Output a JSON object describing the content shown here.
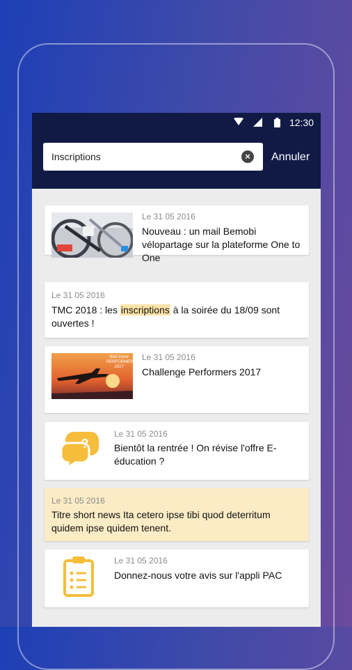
{
  "status_bar": {
    "time": "12:30"
  },
  "search": {
    "value": "Inscriptions",
    "cancel_label": "Annuler"
  },
  "news": [
    {
      "date": "Le 31 05 2016",
      "title": "Nouveau : un mail Bemobi vélopartage sur la plateforme One to One",
      "media": "bike-photo"
    },
    {
      "date": "Le 31 05 2016",
      "title_before": "TMC 2018 : les ",
      "title_highlight": "inscriptions",
      "title_after": " à la soirée du 18/09 sont ouvertes !"
    },
    {
      "date": "Le 31 05 2016",
      "title": "Challenge Performers 2017",
      "media": "airplane-sunset-photo",
      "photo_caption": "Well Done PERFORMERS 2017"
    },
    {
      "date": "Le 31 05 2016",
      "title": "Bientôt la rentrée ! On révise l'offre E-éducation ?",
      "icon": "question-chat-icon"
    },
    {
      "date": "Le 31 05 2016",
      "title": "Titre short news Ita cetero ipse tibi quod deterritum quidem ipse quidem tenent."
    },
    {
      "date": "Le 31 05 2016",
      "title": "Donnez-nous votre avis sur l'appli PAC",
      "icon": "clipboard-survey-icon"
    }
  ],
  "colors": {
    "appbar": "#101a45",
    "accent_yellow": "#f5bd3a",
    "highlight_card": "#fbecc5"
  }
}
